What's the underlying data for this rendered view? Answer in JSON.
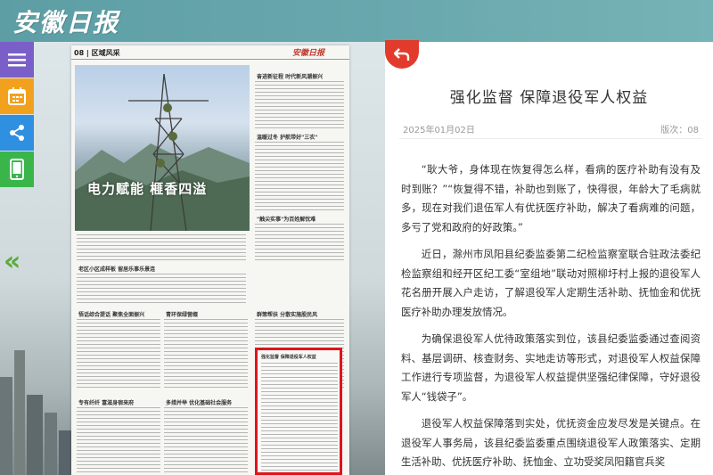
{
  "header": {
    "logo_text": "安徽日报"
  },
  "sidebar": {
    "buttons": [
      {
        "name": "menu",
        "icon": "hamburger-menu-icon",
        "color": "#7b5fc8"
      },
      {
        "name": "calendar",
        "icon": "calendar-icon",
        "color": "#f2a11e"
      },
      {
        "name": "share",
        "icon": "share-icon",
        "color": "#2f8fe0"
      },
      {
        "name": "mobile",
        "icon": "mobile-phone-icon",
        "color": "#39b54a"
      }
    ],
    "prev_page": "«"
  },
  "paper": {
    "section": "08 | 区域风采",
    "brand": "安徽日报",
    "hero_title": "电力赋能  榧香四溢",
    "headlines": [
      "奋进新征程  时代新风潮振兴",
      "温暖过冬  护航带好\"三农\"",
      "\"触尖实事\"为百姓解忧难",
      "老区小区成样板  留居乐事乐景连",
      "悟话综合提话  聚焦全面振兴",
      "青环保绿营缀",
      "群策帮扶  分散实施股民风",
      "专有纤纤  富滋身宿来府",
      "多措并举  优化基础社会服务",
      "强化监督  保障退役军人权益"
    ],
    "highlight_title": "强化监督  保障退役军人权益",
    "highlight_color": "#e0141b"
  },
  "article": {
    "back_label": "↶",
    "title": "强化监督 保障退役军人权益",
    "date": "2025年01月02日",
    "page": "版次：08",
    "paragraphs": [
      "“耿大爷，身体现在恢复得怎么样，看病的医疗补助有没有及时到账？”“恢复得不错，补助也到账了，快得很，年龄大了毛病就多，现在对我们退伍军人有优抚医疗补助，解决了看病难的问题，多亏了党和政府的好政策。”",
      "近日，滁州市凤阳县纪委监委第二纪检监察室联合驻政法委纪检监察组和经开区纪工委“室组地”联动对照柳圩村上报的退役军人花名册开展入户走访，了解退役军人定期生活补助、抚恤金和优抚医疗补助办理发放情况。",
      "为确保退役军人优待政策落实到位，该县纪委监委通过查阅资料、基层调研、核查财务、实地走访等形式，对退役军人权益保障工作进行专项监督，为退役军人权益提供坚强纪律保障，守好退役军人“钱袋子”。",
      "退役军人权益保障落到实处，优抚资金应发尽发是关键点。在退役军人事务局，该县纪委监委重点围绕退役军人政策落实、定期生活补助、优抚医疗补助、抚恤金、立功受奖凤阳籍官兵奖"
    ]
  },
  "colors": {
    "header": "#6aa9ae",
    "back_button": "#e23b2c",
    "prev_arrow": "#5cab3a"
  }
}
